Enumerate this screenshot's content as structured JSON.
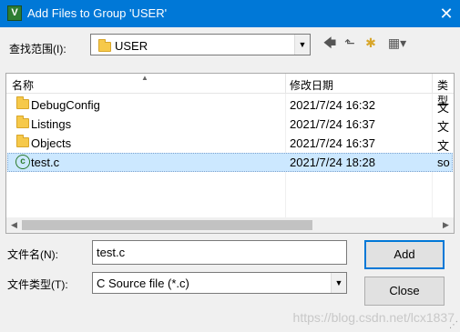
{
  "window": {
    "title": "Add Files to Group 'USER'",
    "app_icon_glyph": "V",
    "close_glyph": "✕"
  },
  "lookin": {
    "label": "查找范围(I):",
    "value": "USER"
  },
  "toolbar": {
    "back_glyph": "🡄",
    "up_glyph": "⬑",
    "new_folder_glyph": "✱",
    "view_glyph": "▦▾"
  },
  "columns": {
    "name": "名称",
    "date": "修改日期",
    "type": "类型"
  },
  "files": [
    {
      "name": "DebugConfig",
      "date": "2021/7/24 16:32",
      "type": "文",
      "kind": "folder"
    },
    {
      "name": "Listings",
      "date": "2021/7/24 16:37",
      "type": "文",
      "kind": "folder"
    },
    {
      "name": "Objects",
      "date": "2021/7/24 16:37",
      "type": "文",
      "kind": "folder"
    },
    {
      "name": "test.c",
      "date": "2021/7/24 18:28",
      "type": "so",
      "kind": "c-file",
      "selected": true
    }
  ],
  "filename": {
    "label": "文件名(N):",
    "value": "test.c"
  },
  "filetype": {
    "label": "文件类型(T):",
    "value": "C Source file (*.c)"
  },
  "buttons": {
    "add": "Add",
    "close": "Close"
  },
  "watermark": "https://blog.csdn.net/lcx1837",
  "colors": {
    "title_bar": "#0078d7",
    "selection": "#cce8ff",
    "folder": "#f6c94a"
  }
}
